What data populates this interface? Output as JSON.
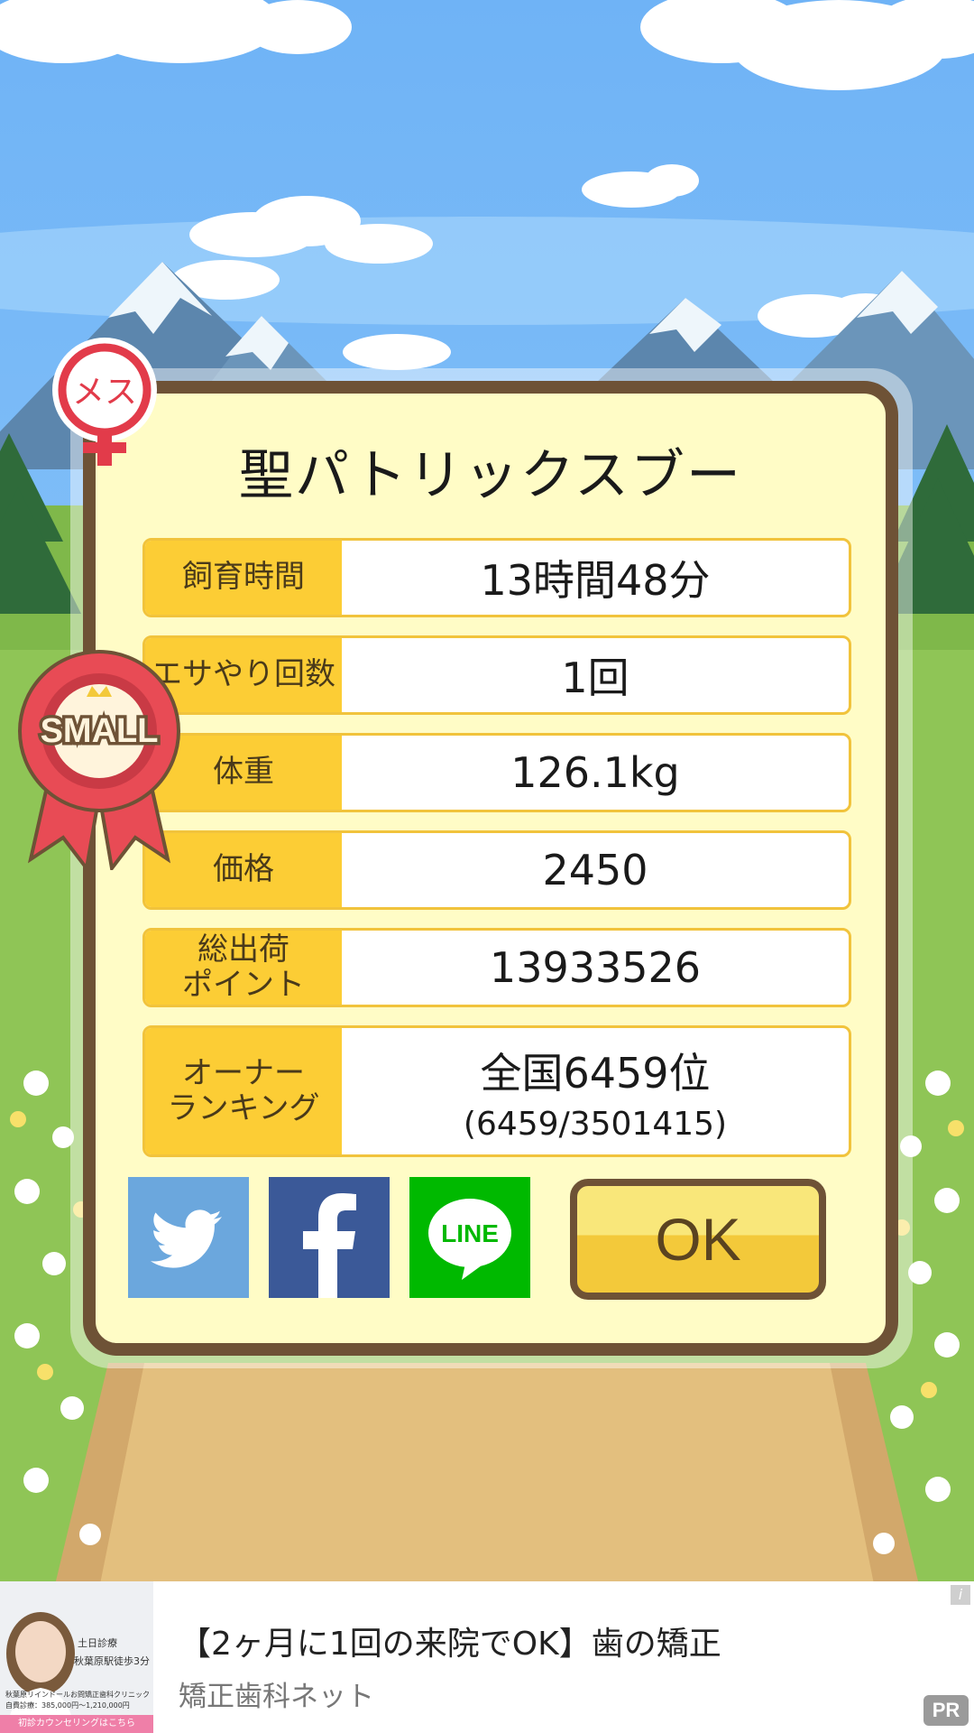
{
  "pig": {
    "name": "聖パトリックスブー",
    "gender_badge": "メス",
    "size_badge": "SMALL"
  },
  "stats": [
    {
      "label": "飼育時間",
      "value": "13時間48分"
    },
    {
      "label": "エサやり回数",
      "value": "1回"
    },
    {
      "label": "体重",
      "value": "126.1kg"
    },
    {
      "label": "価格",
      "value": "2450"
    },
    {
      "label": "総出荷\nポイント",
      "value": "13933526"
    },
    {
      "label": "オーナー\nランキング",
      "value": "全国6459位",
      "sub": "(6459/3501415)"
    }
  ],
  "share": {
    "twitter_icon": "twitter-bird-icon",
    "facebook_icon": "facebook-f-icon",
    "line_label": "LINE"
  },
  "ok_label": "OK",
  "ad": {
    "title": "【2ヶ月に1回の来院でOK】歯の矯正",
    "subtitle": "矯正歯科ネット",
    "badge": "PR",
    "info_icon": "i",
    "thumb_text_1": "土日診療",
    "thumb_text_2": "秋葉原駅徒歩3分",
    "thumb_text_3": "秋葉原リインドールお問矯正歯科クリニック",
    "thumb_text_4": "自費診療：385,000円～1,210,000円",
    "thumb_cta": "初診カウンセリングはこちら"
  },
  "colors": {
    "card_border": "#6e5236",
    "card_bg": "#fffcc6",
    "label_bg": "#fccd35",
    "twitter": "#6ba7dd",
    "facebook": "#3b5998",
    "line": "#00b900",
    "ok_button": "#f9e77a"
  }
}
